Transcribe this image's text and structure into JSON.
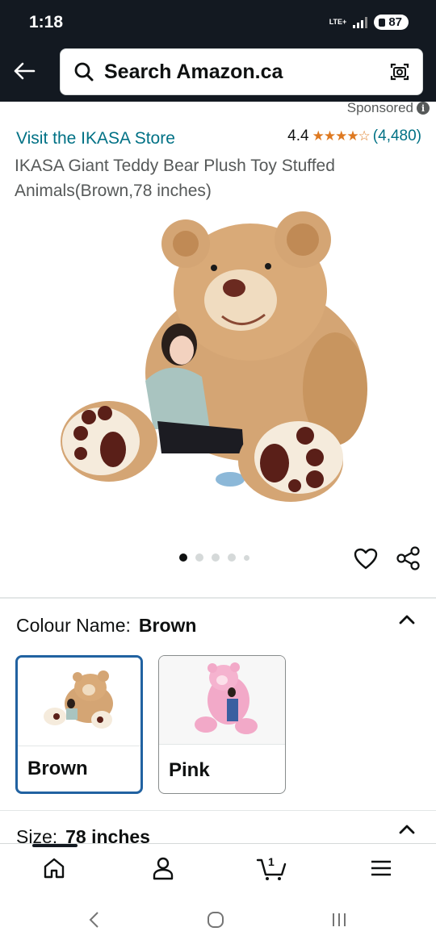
{
  "status_bar": {
    "time": "1:18",
    "network": "LTE+",
    "battery": "87"
  },
  "search": {
    "placeholder": "Search Amazon.ca"
  },
  "sponsored": {
    "label": "Sponsored"
  },
  "product": {
    "store_link": "Visit the IKASA Store",
    "rating": "4.4",
    "stars": "★★★★☆",
    "review_count": "(4,480)",
    "title": "IKASA Giant Teddy Bear Plush Toy Stuffed Animals(Brown,78 inches)"
  },
  "gallery": {
    "image_count": 5,
    "active_index": 0
  },
  "colour": {
    "label": "Colour Name:",
    "selected": "Brown",
    "options": [
      {
        "label": "Brown",
        "selected": true
      },
      {
        "label": "Pink",
        "selected": false
      }
    ]
  },
  "size": {
    "label": "Size:",
    "selected": "78 inches"
  },
  "bottom_nav": {
    "items": [
      "home-icon",
      "account-icon",
      "cart-icon",
      "menu-icon"
    ],
    "cart_count": "1"
  },
  "colors": {
    "header_bg": "#131921",
    "link": "#007185",
    "star": "#de7921",
    "selected_border": "#2162a1"
  }
}
